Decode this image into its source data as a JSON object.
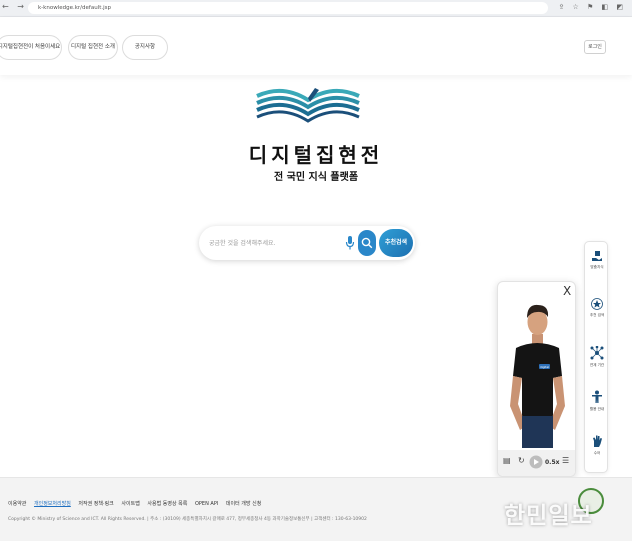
{
  "browser": {
    "nav_icons": "← → C",
    "url": "k-knowledge.kr/default.jsp",
    "tool_icons": "⇪ ☆ ⚑ ◧ ◩"
  },
  "header": {
    "pills": [
      "디지털집현전이 처음이세요",
      "디지털 집현전 소개",
      "공지사항"
    ],
    "login": "로그인"
  },
  "brand": {
    "name": "디지털집현전",
    "tagline": "전 국민 지식 플랫폼"
  },
  "search": {
    "placeholder": "궁금한 것을 검색해주세요.",
    "value": "",
    "recommend_label": "추천검색"
  },
  "quick_menu": [
    {
      "label": "맞춤지식",
      "icon": "hand-book-icon"
    },
    {
      "label": "추천 검색",
      "icon": "star-icon"
    },
    {
      "label": "연계 기관",
      "icon": "network-icon"
    },
    {
      "label": "활용 안내",
      "icon": "person-icon"
    },
    {
      "label": "수어",
      "icon": "sign-language-icon"
    }
  ],
  "avatar_panel": {
    "close": "X",
    "speed": "0.5x",
    "shirt_text": "digital"
  },
  "footer": {
    "links": [
      "이용약관",
      "개인정보처리방침",
      "저작권 정책·링크",
      "사이트맵",
      "사용법 동영상 목록",
      "OPEN API",
      "데이터 개방 신청"
    ],
    "copyright": "Copyright © Ministry of Science and ICT. All Rights Reserved. | 주소 : (30109) 세종특별자치시 갈매로 477, 정부세종청사 4동 과학기술정보통신부 | 고객센터 : 130-63-10902"
  },
  "watermark": "한민일보",
  "colors": {
    "accent": "#2a87c9",
    "logo_teal": "#3aa9b8",
    "logo_navy": "#1b4f7a"
  }
}
